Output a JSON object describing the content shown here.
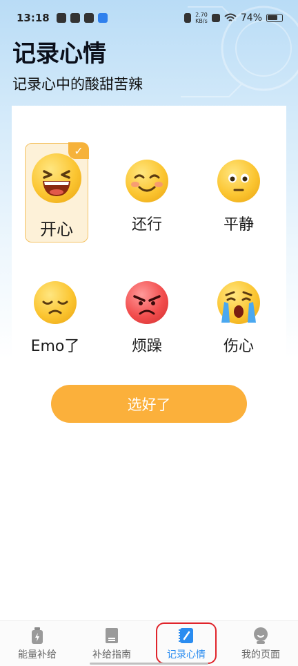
{
  "status_bar": {
    "time": "13:18",
    "net_speed_value": "2.70",
    "net_speed_unit": "KB/s",
    "battery_pct": "74%"
  },
  "header": {
    "title": "记录心情",
    "subtitle": "记录心中的酸甜苦辣"
  },
  "moods": [
    {
      "label": "开心",
      "icon": "laughing-face-icon",
      "selected": true
    },
    {
      "label": "还行",
      "icon": "smiling-face-icon",
      "selected": false
    },
    {
      "label": "平静",
      "icon": "neutral-face-icon",
      "selected": false
    },
    {
      "label": "Emo了",
      "icon": "sad-face-icon",
      "selected": false
    },
    {
      "label": "烦躁",
      "icon": "angry-face-icon",
      "selected": false
    },
    {
      "label": "伤心",
      "icon": "crying-face-icon",
      "selected": false
    }
  ],
  "confirm_button": "选好了",
  "tabs": [
    {
      "label": "能量补给",
      "icon": "energy-bottle-icon",
      "active": false
    },
    {
      "label": "补给指南",
      "icon": "guide-book-icon",
      "active": false
    },
    {
      "label": "记录心情",
      "icon": "mood-notebook-icon",
      "active": true
    },
    {
      "label": "我的页面",
      "icon": "profile-avatar-icon",
      "active": false
    }
  ],
  "colors": {
    "accent": "#fbb03b",
    "active_tab": "#2a8cf0",
    "highlight": "#e0242b"
  }
}
